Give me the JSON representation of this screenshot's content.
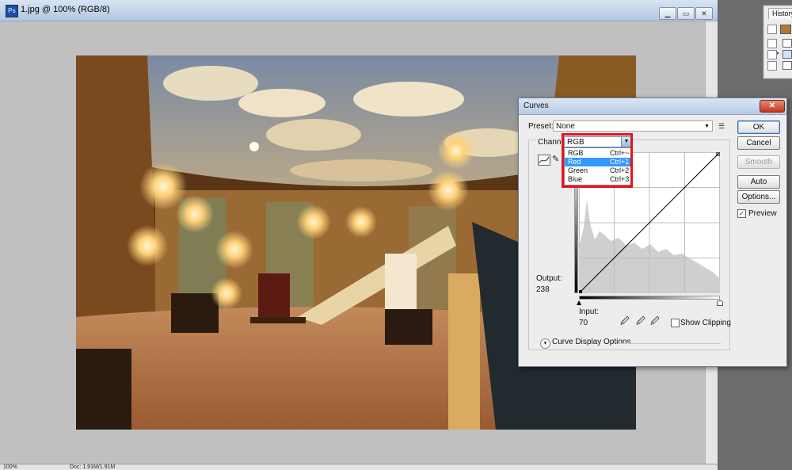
{
  "document": {
    "title": "1.jpg @ 100% (RGB/8)",
    "app_icon": "Ps",
    "zoom": "100%",
    "doc_size": "Doc: 1.91M/1.91M"
  },
  "history": {
    "tab_label": "History"
  },
  "curves": {
    "title": "Curves",
    "close_label": "✕",
    "preset_label": "Preset:",
    "preset_value": "None",
    "channel_label": "Channel:",
    "channel_value": "RGB",
    "channel_options": [
      {
        "name": "RGB",
        "shortcut": "Ctrl+~"
      },
      {
        "name": "Red",
        "shortcut": "Ctrl+1"
      },
      {
        "name": "Green",
        "shortcut": "Ctrl+2"
      },
      {
        "name": "Blue",
        "shortcut": "Ctrl+3"
      }
    ],
    "highlighted_option": "Red",
    "output_label": "Output:",
    "output_value": "238",
    "input_label": "Input:",
    "input_value": "70",
    "show_clipping_label": "Show Clipping",
    "curve_display_options_label": "Curve Display Options",
    "buttons": {
      "ok": "OK",
      "cancel": "Cancel",
      "smooth": "Smooth",
      "auto": "Auto",
      "options": "Options..."
    },
    "preview_label": "Preview",
    "preview_checked": true,
    "highlight_color": "#e8141b"
  }
}
